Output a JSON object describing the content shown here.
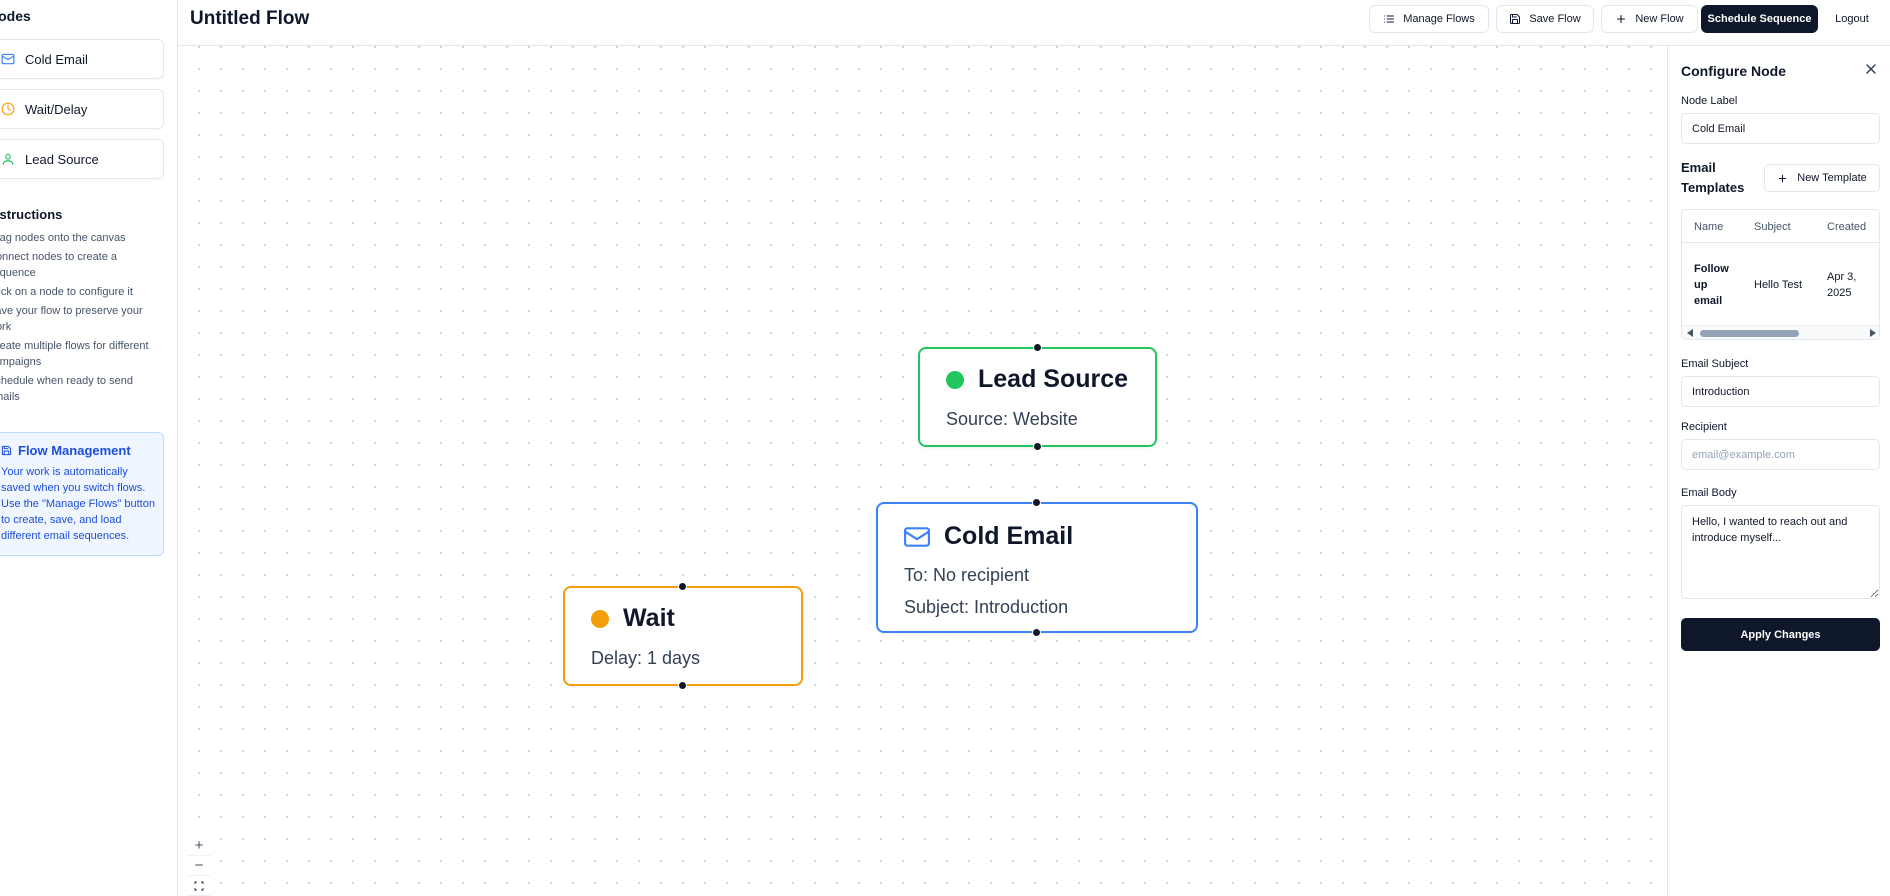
{
  "app": {
    "title": "Untitled Flow"
  },
  "sidebar": {
    "heading": "Nodes",
    "palette": [
      {
        "label": "Cold Email",
        "icon": "mail-icon",
        "color": "#3b82f6"
      },
      {
        "label": "Wait/Delay",
        "icon": "clock-icon",
        "color": "#f59e0b"
      },
      {
        "label": "Lead Source",
        "icon": "user-icon",
        "color": "#22c55e"
      }
    ],
    "instructions_title": "Instructions",
    "instructions": [
      "Drag nodes onto the canvas",
      "Connect nodes to create a sequence",
      "Click on a node to configure it",
      "Save your flow to preserve your work",
      "Create multiple flows for different campaigns",
      "Schedule when ready to send emails"
    ],
    "info": {
      "title": "Flow Management",
      "icon": "save-icon",
      "text": "Your work is automatically saved when you switch flows. Use the \"Manage Flows\" button to create, save, and load different email sequences."
    }
  },
  "toolbar": {
    "manage_flows": "Manage Flows",
    "save_flow": "Save Flow",
    "new_flow": "New Flow",
    "schedule": "Schedule Sequence",
    "logout": "Logout"
  },
  "canvas": {
    "nodes": {
      "lead_source": {
        "title": "Lead Source",
        "lines": [
          "Source: Website"
        ],
        "color": "#22c55e"
      },
      "cold_email": {
        "title": "Cold Email",
        "lines": [
          "To: No recipient",
          "Subject: Introduction"
        ],
        "color": "#3b82f6"
      },
      "wait": {
        "title": "Wait",
        "lines": [
          "Delay: 1 days"
        ],
        "color": "#f59e0b"
      }
    },
    "controls": {
      "zoom_in": "+",
      "zoom_out": "−"
    }
  },
  "panel": {
    "title": "Configure Node",
    "node_label_label": "Node Label",
    "node_label_value": "Cold Email",
    "templates_label": "Email Templates",
    "new_template": "New Template",
    "table": {
      "columns": [
        "Name",
        "Subject",
        "Created"
      ],
      "rows": [
        {
          "name": "Follow up email",
          "subject": "Hello Test",
          "created": "Apr 3, 2025"
        }
      ]
    },
    "subject_label": "Email Subject",
    "subject_value": "Introduction",
    "recipient_label": "Recipient",
    "recipient_placeholder": "email@example.com",
    "body_label": "Email Body",
    "body_value": "Hello, I wanted to reach out and introduce myself...",
    "apply": "Apply Changes"
  },
  "colors": {
    "primary": "#0f172a",
    "info_bg": "#eff6ff",
    "info_text": "#1d4ed8"
  }
}
